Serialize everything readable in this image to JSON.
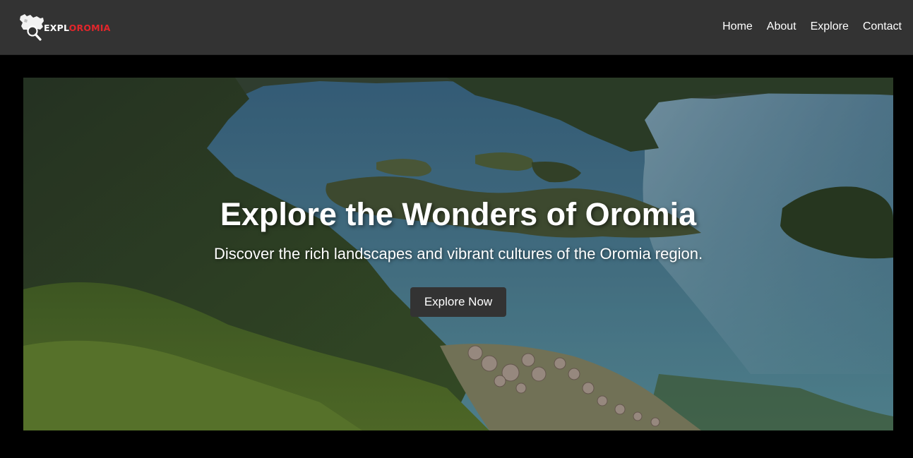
{
  "header": {
    "logo": {
      "text_part1": "EXPL",
      "text_part2": "OROMIA",
      "icon": "map-magnifier-icon",
      "accent_color": "#e2262b"
    },
    "nav": [
      {
        "label": "Home"
      },
      {
        "label": "About"
      },
      {
        "label": "Explore"
      },
      {
        "label": "Contact"
      }
    ],
    "background_color": "#333333"
  },
  "hero": {
    "title": "Explore the Wonders of Oromia",
    "subtitle": "Discover the rich landscapes and vibrant cultures of the Oromia region.",
    "button_label": "Explore Now",
    "button_color": "#333333"
  }
}
